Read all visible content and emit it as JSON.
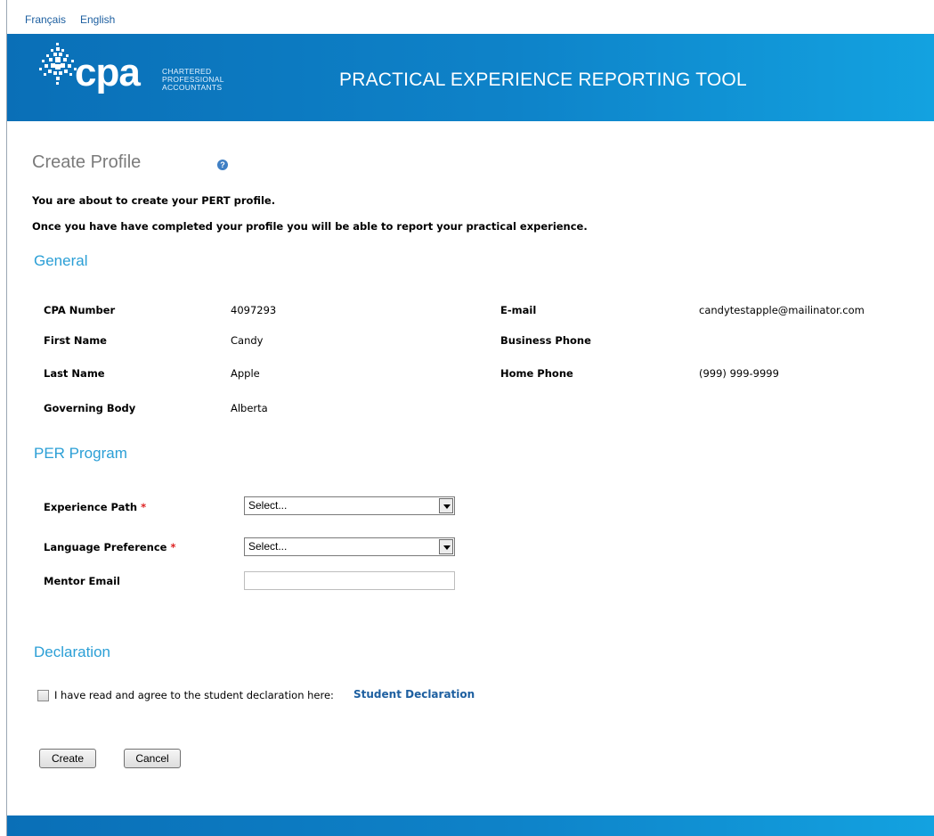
{
  "topbar": {
    "lang_fr": "Français",
    "lang_en": "English"
  },
  "header": {
    "logo_text": "cpa",
    "logo_sub": [
      "CHARTERED",
      "PROFESSIONAL",
      "ACCOUNTANTS"
    ],
    "title": "PRACTICAL EXPERIENCE REPORTING TOOL"
  },
  "page": {
    "title": "Create Profile",
    "help_icon": "?",
    "intro_1": "You are about to create your PERT profile.",
    "intro_2": "Once you have have completed your profile you will be able to report your practical experience."
  },
  "general": {
    "title": "General",
    "left": [
      {
        "label": "CPA Number",
        "value": "4097293"
      },
      {
        "label": "First Name",
        "value": "Candy"
      },
      {
        "label": "Last Name",
        "value": "Apple"
      },
      {
        "label": "Governing Body",
        "value": "Alberta"
      }
    ],
    "right": [
      {
        "label": "E-mail",
        "value": "candytestapple@mailinator.com"
      },
      {
        "label": "Business Phone",
        "value": ""
      },
      {
        "label": "Home Phone",
        "value": "(999) 999-9999"
      }
    ]
  },
  "per_program": {
    "title": "PER Program",
    "experience_path_label": "Experience Path",
    "experience_path_value": "Select...",
    "language_pref_label": "Language Preference",
    "language_pref_value": "Select...",
    "mentor_email_label": "Mentor Email",
    "mentor_email_value": "",
    "required_mark": "*"
  },
  "declaration": {
    "title": "Declaration",
    "text": "I have read and agree to the student declaration here:",
    "link": "Student Declaration",
    "checked": false
  },
  "buttons": {
    "create": "Create",
    "cancel": "Cancel"
  },
  "colors": {
    "brand_blue": "#0e83c9",
    "section_title": "#2b9fd6",
    "link": "#1d5fa0",
    "required": "#dd2222"
  }
}
